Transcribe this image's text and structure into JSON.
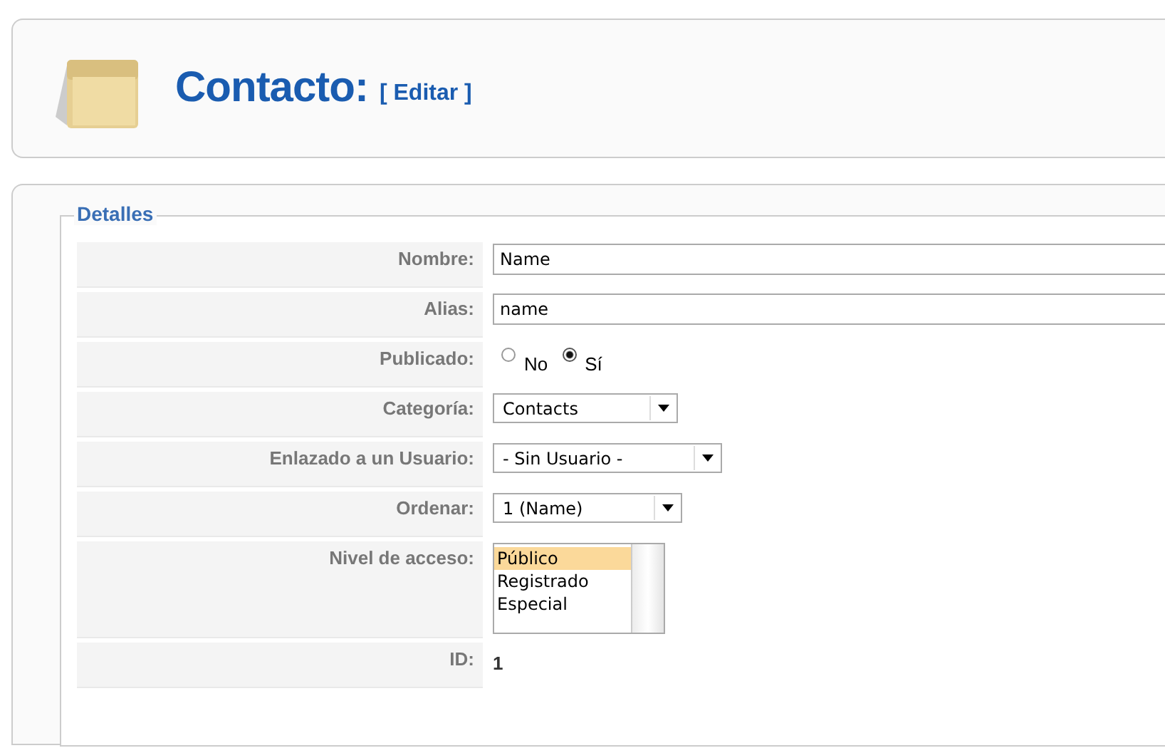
{
  "header": {
    "title": "Contacto:",
    "subtitle": "[ Editar ]"
  },
  "fieldset": {
    "legend": "Detalles",
    "fields": [
      {
        "kind": "text",
        "label": "Nombre:",
        "value": "Name"
      },
      {
        "kind": "text",
        "label": "Alias:",
        "value": "name"
      },
      {
        "kind": "radio",
        "label": "Publicado:",
        "options": [
          {
            "label": "No",
            "selected": false
          },
          {
            "label": "Sí",
            "selected": true
          }
        ]
      },
      {
        "kind": "select",
        "label": "Categoría:",
        "value": "Contacts"
      },
      {
        "kind": "select",
        "label": "Enlazado a un Usuario:",
        "value": "- Sin Usuario -"
      },
      {
        "kind": "select",
        "label": "Ordenar:",
        "value": "1 (Name)"
      },
      {
        "kind": "listbox",
        "label": "Nivel de acceso:",
        "options": [
          {
            "label": "Público",
            "selected": true
          },
          {
            "label": "Registrado",
            "selected": false
          },
          {
            "label": "Especial",
            "selected": false
          }
        ]
      },
      {
        "kind": "static",
        "label": "ID:",
        "value": "1"
      }
    ]
  }
}
